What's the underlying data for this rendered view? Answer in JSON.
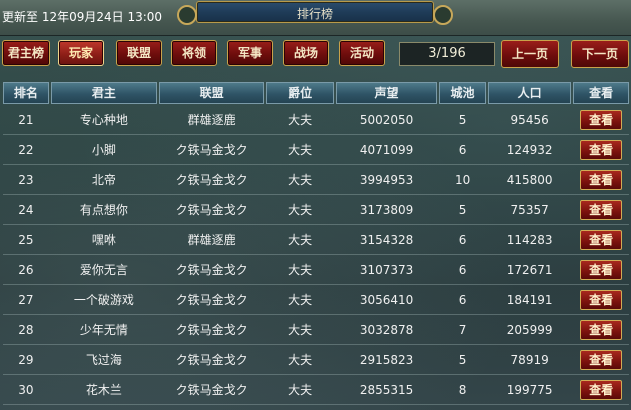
{
  "header": {
    "update_label": "更新至 12年09月24日 13:00",
    "title": "排行榜"
  },
  "tabs": [
    {
      "label": "君主榜",
      "active": false
    },
    {
      "label": "玩家",
      "active": true
    },
    {
      "label": "联盟",
      "active": false
    },
    {
      "label": "将领",
      "active": false
    },
    {
      "label": "军事",
      "active": false
    },
    {
      "label": "战场",
      "active": false
    },
    {
      "label": "活动",
      "active": false
    }
  ],
  "pager": {
    "page_indicator": "3/196",
    "prev_label": "上一页",
    "next_label": "下一页"
  },
  "table": {
    "columns": [
      "排名",
      "君主",
      "联盟",
      "爵位",
      "声望",
      "城池",
      "人口",
      "查看"
    ],
    "view_label": "查看",
    "rows": [
      {
        "rank": "21",
        "lord": "专心种地",
        "alliance": "群雄逐鹿",
        "title": "大夫",
        "prestige": "5002050",
        "cities": "5",
        "population": "95456"
      },
      {
        "rank": "22",
        "lord": "小脚",
        "alliance": "ク铁马金戈ク",
        "title": "大夫",
        "prestige": "4071099",
        "cities": "6",
        "population": "124932"
      },
      {
        "rank": "23",
        "lord": "北帝",
        "alliance": "ク铁马金戈ク",
        "title": "大夫",
        "prestige": "3994953",
        "cities": "10",
        "population": "415800"
      },
      {
        "rank": "24",
        "lord": "有点想你",
        "alliance": "ク铁马金戈ク",
        "title": "大夫",
        "prestige": "3173809",
        "cities": "5",
        "population": "75357"
      },
      {
        "rank": "25",
        "lord": "嘿咻",
        "alliance": "群雄逐鹿",
        "title": "大夫",
        "prestige": "3154328",
        "cities": "6",
        "population": "114283"
      },
      {
        "rank": "26",
        "lord": "爱你无言",
        "alliance": "ク铁马金戈ク",
        "title": "大夫",
        "prestige": "3107373",
        "cities": "6",
        "population": "172671"
      },
      {
        "rank": "27",
        "lord": "一个破游戏",
        "alliance": "ク铁马金戈ク",
        "title": "大夫",
        "prestige": "3056410",
        "cities": "6",
        "population": "184191"
      },
      {
        "rank": "28",
        "lord": "少年无情",
        "alliance": "ク铁马金戈ク",
        "title": "大夫",
        "prestige": "3032878",
        "cities": "7",
        "population": "205999"
      },
      {
        "rank": "29",
        "lord": "飞过海",
        "alliance": "ク铁马金戈ク",
        "title": "大夫",
        "prestige": "2915823",
        "cities": "5",
        "population": "78919"
      },
      {
        "rank": "30",
        "lord": "花木兰",
        "alliance": "ク铁马金戈ク",
        "title": "大夫",
        "prestige": "2855315",
        "cities": "8",
        "population": "199775"
      }
    ]
  },
  "colors": {
    "tab_red": "#7a110d",
    "tab_border_gold": "#c9a24a",
    "header_blue": "#2f5466"
  }
}
